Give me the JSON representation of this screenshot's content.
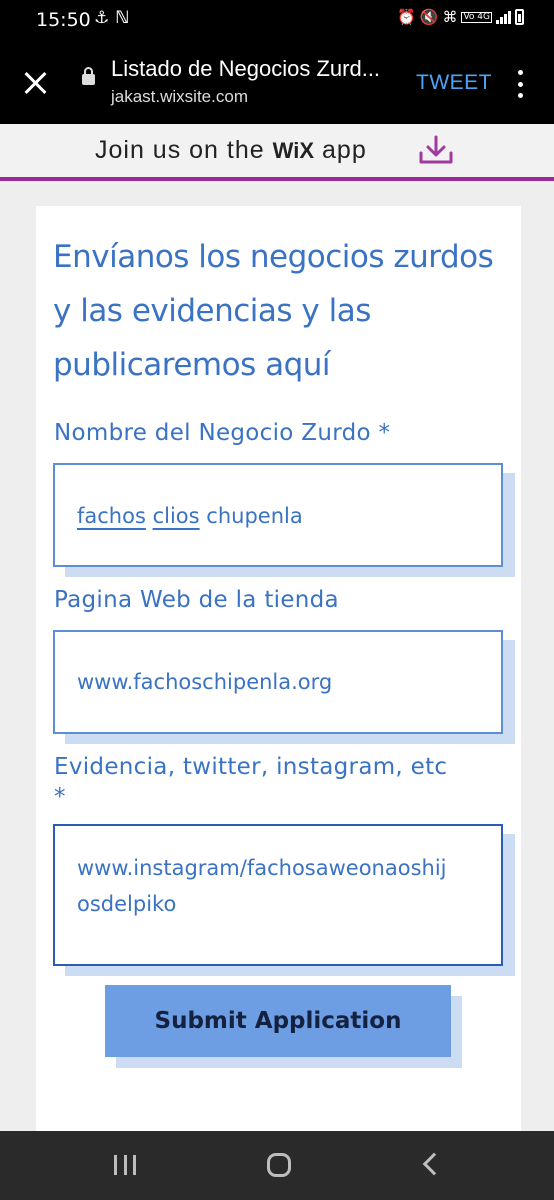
{
  "status_bar": {
    "time": "15:50",
    "network_badge": "Vo 4G"
  },
  "browser": {
    "page_title": "Listado de Negocios Zurd...",
    "url": "jakast.wixsite.com",
    "tweet_label": "TWEET"
  },
  "banner": {
    "text_before": "Join us on the",
    "brand": "WiX",
    "text_after": "app",
    "accent_color": "#9a2a96"
  },
  "form": {
    "heading": "Envíanos los negocios zurdos y las evidencias y las publicaremos aquí",
    "fields": [
      {
        "label": "Nombre del Negocio Zurdo *",
        "value_words": [
          "fachos",
          "clios",
          "chupenla"
        ]
      },
      {
        "label": "Pagina Web de la tienda",
        "value": "www.fachoschipenla.org"
      },
      {
        "label": "Evidencia, twitter, instagram, etc",
        "label_suffix": "*",
        "value_line1": "www.instagram/fachosaweonaoshij",
        "value_line2": "osdelpiko"
      }
    ],
    "submit_label": "Submit Application",
    "accent_color": "#3a72c4"
  }
}
